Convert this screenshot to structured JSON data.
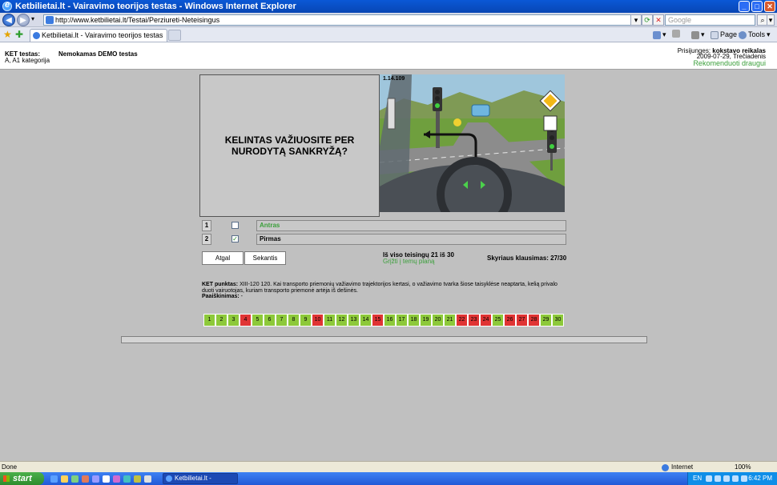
{
  "window": {
    "title": "Ketbilietai.lt - Vairavimo teorijos testas - Windows Internet Explorer"
  },
  "browser": {
    "url": "http://www.ketbilietai.lt/Testai/Perziureti-Neteisingus",
    "search_placeholder": "Google",
    "tab_title": "Ketbilietai.lt - Vairavimo teorijos testas",
    "page_label": "Page",
    "tools_label": "Tools",
    "status": "Done",
    "zone": "Internet",
    "zoom": "100%"
  },
  "header": {
    "ket_label": "KET testas:",
    "category": "A, A1 kategorija",
    "demo_label": "Nemokamas DEMO testas",
    "login_prefix": "Prisijunges:",
    "login_user": "kokstavo reikalas",
    "date": "2009-07-29, Trečiadenis",
    "recommend": "Rekomenduoti draugui"
  },
  "question": {
    "text": "KELINTAS VAŽIUOSITE PER NURODYTĄ SANKRYŽĄ?",
    "image_id": "1.14.109"
  },
  "answers": [
    {
      "num": "1",
      "text": "Antras",
      "checked": false,
      "correct": true
    },
    {
      "num": "2",
      "text": "Pirmas",
      "checked": true,
      "correct": false
    }
  ],
  "buttons": {
    "back": "Atgal",
    "next": "Sekantis"
  },
  "stats": {
    "correct_line": "Iš viso teisingų 21 iš 30",
    "back_link": "Grįžti į temų planą",
    "section_line": "Skyriaus klausimas: 27/30"
  },
  "explanation": {
    "punktas_label": "KET punktas:",
    "punktas_text": "XIII-120 120. Kai transporto priemonių važiavimo trajektorijos kertasi, o važiavimo tvarka šiose taisyklėse neaptarta, kelią privalo duoti vairuotojas, kuriam transporto priemonė artėja iš dešinės.",
    "paaisk_label": "Paaiškinimas:",
    "paaisk_text": "-"
  },
  "question_grid": [
    {
      "n": "1",
      "ok": true
    },
    {
      "n": "2",
      "ok": true
    },
    {
      "n": "3",
      "ok": true
    },
    {
      "n": "4",
      "ok": false
    },
    {
      "n": "5",
      "ok": true
    },
    {
      "n": "6",
      "ok": true
    },
    {
      "n": "7",
      "ok": true
    },
    {
      "n": "8",
      "ok": true
    },
    {
      "n": "9",
      "ok": true
    },
    {
      "n": "10",
      "ok": false
    },
    {
      "n": "11",
      "ok": true
    },
    {
      "n": "12",
      "ok": true
    },
    {
      "n": "13",
      "ok": true
    },
    {
      "n": "14",
      "ok": true
    },
    {
      "n": "15",
      "ok": false
    },
    {
      "n": "16",
      "ok": true
    },
    {
      "n": "17",
      "ok": true
    },
    {
      "n": "18",
      "ok": true
    },
    {
      "n": "19",
      "ok": true
    },
    {
      "n": "20",
      "ok": true
    },
    {
      "n": "21",
      "ok": true
    },
    {
      "n": "22",
      "ok": false
    },
    {
      "n": "23",
      "ok": false
    },
    {
      "n": "24",
      "ok": false
    },
    {
      "n": "25",
      "ok": true
    },
    {
      "n": "26",
      "ok": false
    },
    {
      "n": "27",
      "ok": false
    },
    {
      "n": "28",
      "ok": false
    },
    {
      "n": "29",
      "ok": true
    },
    {
      "n": "30",
      "ok": true
    }
  ],
  "taskbar": {
    "start": "start",
    "task": "Ketbilietai.lt - Vairavi...",
    "lang": "EN",
    "clock": "6:42 PM"
  },
  "colors": {
    "correct": "#8dc93a",
    "wrong": "#e03434",
    "link": "#3a9f3a"
  }
}
